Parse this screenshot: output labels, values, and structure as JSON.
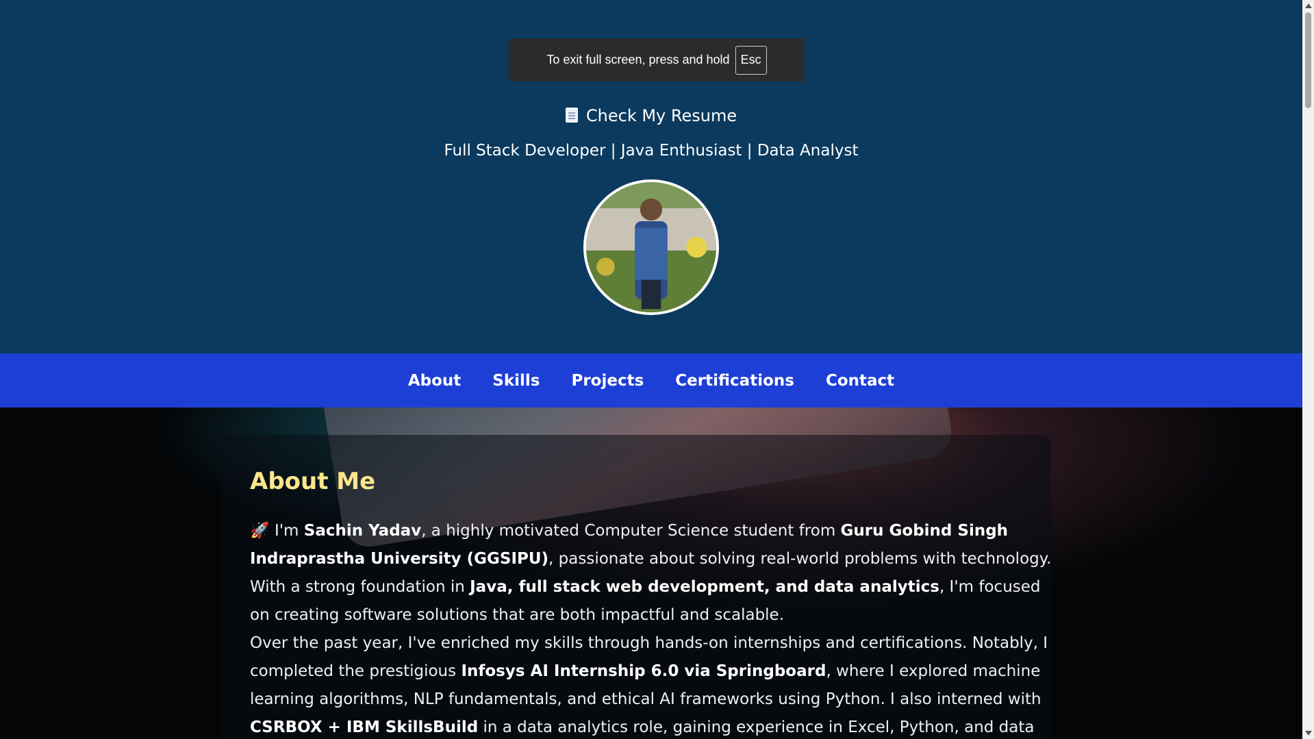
{
  "fullscreen_toast": {
    "message": "To exit full screen, press and hold",
    "key": "Esc"
  },
  "header": {
    "resume_link": "Check My Resume",
    "tagline": "Full Stack Developer | Java Enthusiast | Data Analyst"
  },
  "nav": {
    "items": [
      "About",
      "Skills",
      "Projects",
      "Certifications",
      "Contact"
    ]
  },
  "about": {
    "title": "About Me",
    "p1": [
      "🚀 I'm ",
      "Sachin Yadav",
      ", a highly motivated Computer Science student from ",
      "Guru Gobind Singh Indraprastha University (GGSIPU)",
      ", passionate about solving real-world problems with technology. With a strong foundation in ",
      "Java, full stack web development, and data analytics",
      ", I'm focused on creating software solutions that are both impactful and scalable."
    ],
    "p2": [
      "Over the past year, I've enriched my skills through hands-on internships and certifications. Notably, I completed the prestigious ",
      "Infosys AI Internship 6.0 via Springboard",
      ", where I explored machine learning algorithms, NLP fundamentals, and ethical AI frameworks using Python. I also interned with ",
      "CSRBOX + IBM SkillsBuild",
      " in a data analytics role, gaining experience in Excel, Python, and data visualization tools to"
    ]
  },
  "colors": {
    "header_bg": "#0b3a5e",
    "nav_bg": "#1e3fd6",
    "about_title": "#fde68a"
  }
}
